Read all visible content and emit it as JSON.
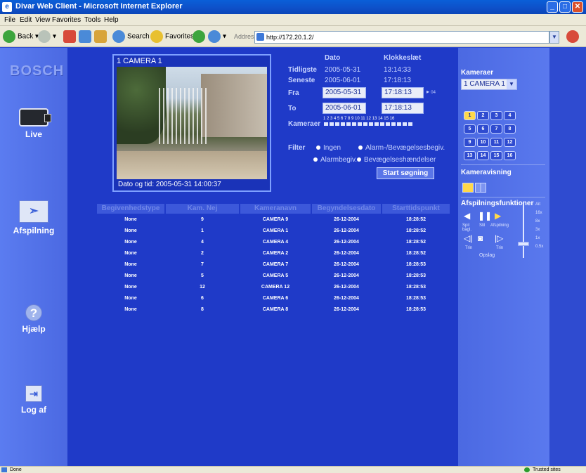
{
  "window": {
    "title": "Divar Web Client - Microsoft Internet Explorer",
    "icon_name": "ie-icon"
  },
  "menu": {
    "items": [
      "File",
      "Edit",
      "View",
      "Favorites",
      "Tools",
      "Help"
    ]
  },
  "toolbar": {
    "back_label": "Back",
    "search_label": "Search",
    "favorites_label": "Favorites",
    "address_label": "Address",
    "address_value": "http://172.20.1.2/"
  },
  "nav": {
    "logo": "BOSCH",
    "live": "Live",
    "afspilning": "Afspilning",
    "hjaelp": "Hjælp",
    "logaf": "Log af"
  },
  "video": {
    "camera_title": "1 CAMERA 1",
    "timestamp": "Dato og tid:  2005-05-31 14:00:37"
  },
  "search": {
    "col_dato": "Dato",
    "col_klokkeslaet": "Klokkeslæt",
    "tidligste_label": "Tidligste",
    "tidligste_dato": "2005-05-31",
    "tidligste_tid": "13:14:33",
    "seneste_label": "Seneste",
    "seneste_dato": "2005-06-01",
    "seneste_tid": "17:18:13",
    "fra_label": "Fra",
    "fra_dato": "2005-05-31",
    "fra_tid": "17:18:13",
    "fra_suffix": "04",
    "to_label": "To",
    "to_dato": "2005-06-01",
    "to_tid": "17:18:13",
    "kameraer_label": "Kameraer",
    "camera_numbers": "1 2 3 4 5 6 7 8 9 10 11 12 13 14 15 16",
    "filter_label": "Filter",
    "filter_ingen": "Ingen",
    "filter_alarm_bev": "Alarm-/Bevægelsesbegiv.",
    "filter_alarmbegiv": "Alarmbegiv.",
    "filter_bevaegelse": "Bevægelseshændelser",
    "start_button": "Start søgning"
  },
  "results": {
    "headers": [
      "Begivenhedstype",
      "Kam. Nej",
      "Kameranavn",
      "Begyndelsesdato",
      "Starttidspunkt"
    ],
    "rows": [
      [
        "None",
        "9",
        "CAMERA 9",
        "26-12-2004",
        "18:28:52"
      ],
      [
        "None",
        "1",
        "CAMERA 1",
        "26-12-2004",
        "18:28:52"
      ],
      [
        "None",
        "4",
        "CAMERA 4",
        "26-12-2004",
        "18:28:52"
      ],
      [
        "None",
        "2",
        "CAMERA 2",
        "26-12-2004",
        "18:28:52"
      ],
      [
        "None",
        "7",
        "CAMERA 7",
        "26-12-2004",
        "18:28:53"
      ],
      [
        "None",
        "5",
        "CAMERA 5",
        "26-12-2004",
        "18:28:53"
      ],
      [
        "None",
        "12",
        "CAMERA 12",
        "26-12-2004",
        "18:28:53"
      ],
      [
        "None",
        "6",
        "CAMERA 6",
        "26-12-2004",
        "18:28:53"
      ],
      [
        "None",
        "8",
        "CAMERA 8",
        "26-12-2004",
        "18:28:53"
      ]
    ]
  },
  "right": {
    "kameraer_title": "Kameraer",
    "camera_select": "1 CAMERA 1",
    "camera_buttons": [
      "1",
      "2",
      "3",
      "4",
      "5",
      "6",
      "7",
      "8",
      "9",
      "10",
      "11",
      "12",
      "13",
      "14",
      "15",
      "16"
    ],
    "kameravisning_title": "Kameravisning",
    "afspilning_title": "Afspilningsfunktioner",
    "ctrl_labels": [
      "Spil bagl.",
      "Stil",
      "Afspilning",
      "Trin",
      "Trin"
    ],
    "opslag_label": "Opslag",
    "speed_labels": [
      "Ait",
      "16x",
      "8x",
      "3x",
      "1x",
      "0.5x"
    ]
  },
  "status": {
    "left": "Done",
    "right": "Trusted sites"
  },
  "colors": {
    "main_bg": "#1f3ac8",
    "panel_bg": "#4b69e2",
    "active_camera": "#ffd84a"
  }
}
